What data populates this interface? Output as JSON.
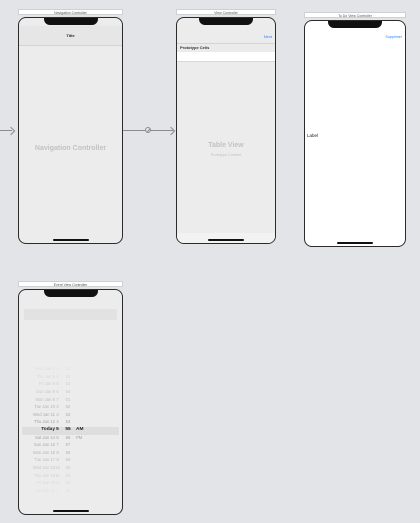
{
  "scenes": {
    "nav": {
      "title": "Navigation Controller",
      "navbar_title": "Title",
      "placeholder": "Navigation Controller"
    },
    "view": {
      "title": "View Controller",
      "nav_button": "Next",
      "section_header": "Prototype Cells",
      "placeholder": "Table View",
      "sub_placeholder": "Prototype Content"
    },
    "todo": {
      "title": "To Do View Controller",
      "nav_button": "Supprimer",
      "label": "Label"
    },
    "event": {
      "title": "Event View Controller"
    }
  },
  "date_picker": {
    "rows": [
      {
        "date": "Wed Jan 4",
        "hour": "3",
        "minute": "51",
        "ampm": ""
      },
      {
        "date": "Thu Jan 5",
        "hour": "4",
        "minute": "52",
        "ampm": ""
      },
      {
        "date": "Fri Jan 6",
        "hour": "5",
        "minute": "53",
        "ampm": ""
      },
      {
        "date": "Sun Jan 8",
        "hour": "6",
        "minute": "54",
        "ampm": ""
      },
      {
        "date": "Mon Jan 9",
        "hour": "7",
        "minute": "01",
        "ampm": ""
      },
      {
        "date": "Tue Jan 10",
        "hour": "2",
        "minute": "52",
        "ampm": ""
      },
      {
        "date": "Wed Jan 11",
        "hour": "3",
        "minute": "53",
        "ampm": ""
      },
      {
        "date": "Thu Jan 12",
        "hour": "4",
        "minute": "54",
        "ampm": ""
      },
      {
        "date": "Today",
        "hour": "5",
        "minute": "55",
        "ampm": "AM",
        "selected": true
      },
      {
        "date": "Sat Jan 14",
        "hour": "6",
        "minute": "56",
        "ampm": "PM"
      },
      {
        "date": "Sun Jan 15",
        "hour": "7",
        "minute": "57",
        "ampm": ""
      },
      {
        "date": "Mon Jan 16",
        "hour": "8",
        "minute": "58",
        "ampm": ""
      },
      {
        "date": "Tue Jan 17",
        "hour": "9",
        "minute": "59",
        "ampm": ""
      },
      {
        "date": "Wed Jan 18",
        "hour": "10",
        "minute": "00",
        "ampm": ""
      },
      {
        "date": "Thu Jan 19",
        "hour": "11",
        "minute": "01",
        "ampm": ""
      },
      {
        "date": "Fri Jan 20",
        "hour": "12",
        "minute": "02",
        "ampm": ""
      },
      {
        "date": "Sat Jan 21",
        "hour": "1",
        "minute": "03",
        "ampm": ""
      }
    ]
  },
  "colors": {
    "canvas": "#e3e4e8",
    "accent": "#2f7ef6"
  }
}
